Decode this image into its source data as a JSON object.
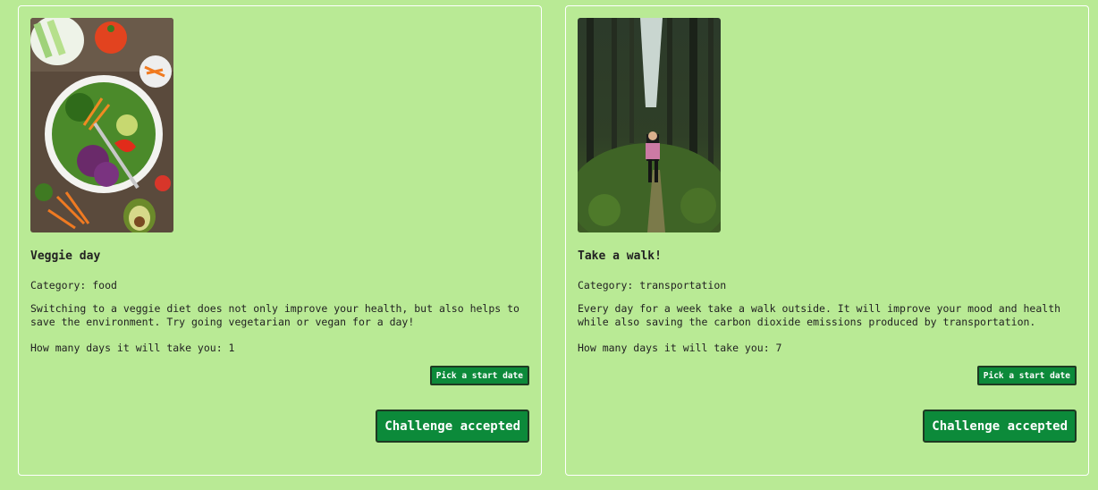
{
  "challenges": [
    {
      "title": "Veggie day",
      "category": "Category: food",
      "description": "Switching to a veggie diet does not only improve your health, but also helps to save the environment. Try going vegetarian or vegan for a day!",
      "days": "How many days it will take you: 1",
      "date_button": "Pick a start date",
      "accept_button": "Challenge accepted",
      "image": "salad-bowl-photo"
    },
    {
      "title": "Take a walk!",
      "category": "Category: transportation",
      "description": "Every day for a week take a walk outside. It will improve your mood and health while also saving the carbon dioxide emissions produced by transportation.",
      "days": "How many days it will take you: 7",
      "date_button": "Pick a start date",
      "accept_button": "Challenge accepted",
      "image": "forest-walk-photo"
    }
  ],
  "colors": {
    "background": "#b9ea95",
    "button": "#0c8a3a",
    "card_border": "#ffffff"
  }
}
